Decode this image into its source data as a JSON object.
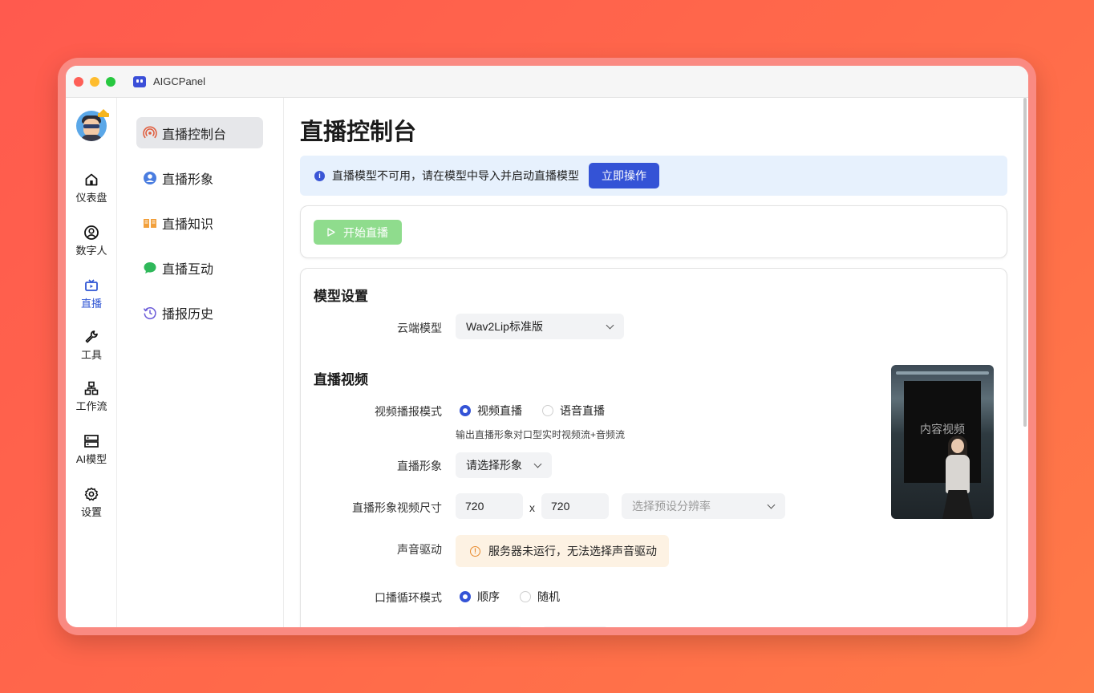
{
  "window": {
    "title": "AIGCPanel"
  },
  "rail": {
    "items": [
      {
        "label": "仪表盘",
        "icon": "home-icon"
      },
      {
        "label": "数字人",
        "icon": "user-circle-icon"
      },
      {
        "label": "直播",
        "icon": "tv-icon"
      },
      {
        "label": "工具",
        "icon": "wrench-icon"
      },
      {
        "label": "工作流",
        "icon": "workflow-icon"
      },
      {
        "label": "AI模型",
        "icon": "server-icon"
      },
      {
        "label": "设置",
        "icon": "gear-icon"
      }
    ],
    "active_color": "#2f55d4"
  },
  "subnav": {
    "items": [
      {
        "label": "直播控制台",
        "icon": "broadcast-icon"
      },
      {
        "label": "直播形象",
        "icon": "avatar-icon"
      },
      {
        "label": "直播知识",
        "icon": "book-icon"
      },
      {
        "label": "直播互动",
        "icon": "chat-icon"
      },
      {
        "label": "播报历史",
        "icon": "history-icon"
      }
    ]
  },
  "main": {
    "title": "直播控制台",
    "alert": {
      "message": "直播模型不可用，请在模型中导入并启动直播模型",
      "action": "立即操作"
    },
    "start_button": "开始直播",
    "model_section": {
      "title": "模型设置",
      "cloud_model_label": "云端模型",
      "cloud_model_value": "Wav2Lip标准版"
    },
    "video_section": {
      "title": "直播视频",
      "mode_label": "视频播报模式",
      "mode_options": [
        "视频直播",
        "语音直播"
      ],
      "mode_selected": "视频直播",
      "mode_hint": "输出直播形象对口型实时视频流+音频流",
      "avatar_label": "直播形象",
      "avatar_placeholder": "请选择形象",
      "size_label": "直播形象视频尺寸",
      "width": "720",
      "times": "x",
      "height": "720",
      "preset_placeholder": "选择预设分辨率",
      "voice_label": "声音驱动",
      "voice_warning": "服务器未运行，无法选择声音驱动",
      "loop_label": "口播循环模式",
      "loop_options": [
        "顺序",
        "随机"
      ],
      "loop_selected": "顺序",
      "preview_label": "内容视频"
    }
  },
  "colors": {
    "primary": "#3453d6",
    "start_disabled": "#8fdc8d",
    "alert_bg": "#e7f1fd",
    "warn_bg": "#fdf2e3"
  }
}
